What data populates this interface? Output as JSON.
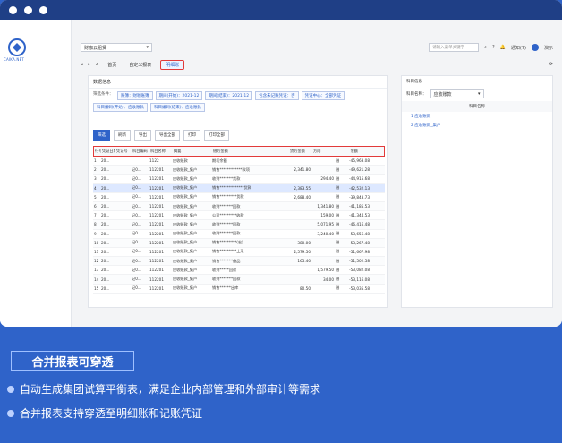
{
  "window": {
    "dots": 3
  },
  "brand": {
    "name": "财咖",
    "small": "CAIKA.NET"
  },
  "topbar": {
    "org_select": "财咖云租赁",
    "search_placeholder": "请输入菜单关键字",
    "notifications": "通知(7)",
    "user": "演示"
  },
  "tabs": [
    {
      "label": "首页"
    },
    {
      "label": "自定义报表"
    },
    {
      "label": "明细账"
    }
  ],
  "panel": {
    "title": "数据信息",
    "filter_label": "筛选条件：",
    "filters": [
      "账簿：财咖账簿",
      "期间(开始)：2021-12",
      "期间(结束)：2021-12",
      "包含未记账凭证：否",
      "凭证中心：全部凭证",
      "科目编码(开始)：应收账款",
      "科目编码(结束)：应收账款"
    ],
    "actions": [
      "筛选",
      "刷新",
      "导出",
      "导出全部",
      "打印",
      "打印全部"
    ],
    "columns": [
      "行号",
      "凭证日期",
      "凭证号",
      "科目编码",
      "科目名称",
      "摘要",
      "借方金额",
      "贷方金额",
      "方向",
      "余额"
    ],
    "rows": [
      [
        "1",
        "20...",
        "",
        "",
        "1122",
        "应收账款",
        "期初余额",
        "",
        "",
        "借",
        "-45,963.08"
      ],
      [
        "2",
        "20...",
        "",
        "记0...",
        "112201",
        "应收账款_集户",
        "销售************款项",
        "2,341.80",
        "",
        "借",
        "-49,621.28"
      ],
      [
        "3",
        "20...",
        "",
        "记0...",
        "112201",
        "应收账款_集户",
        "收到*******货款",
        "",
        "294.40",
        "借",
        "-44,915.68"
      ],
      [
        "4",
        "20...",
        "",
        "记0...",
        "112201",
        "应收账款_集户",
        "销售*************货款",
        "2,383.55",
        "",
        "借",
        "-42,532.13"
      ],
      [
        "5",
        "20...",
        "",
        "记0...",
        "112201",
        "应收账款_集户",
        "销售*********货款",
        "2,688.40",
        "",
        "借",
        "-39,843.73"
      ],
      [
        "6",
        "20...",
        "",
        "记0...",
        "112201",
        "应收账款_集户",
        "收到*******回款",
        "",
        "1,341.80",
        "借",
        "-41,185.53"
      ],
      [
        "7",
        "20...",
        "",
        "记0...",
        "112201",
        "应收账款_集户",
        "公司*********收款",
        "",
        "159.00",
        "借",
        "-41,344.53"
      ],
      [
        "8",
        "20...",
        "",
        "记0...",
        "112201",
        "应收账款_集户",
        "收到*******回款",
        "",
        "5,071.95",
        "借",
        "-46,416.48"
      ],
      [
        "9",
        "20...",
        "",
        "记0...",
        "112201",
        "应收账款_集户",
        "收到*******回款",
        "",
        "3,240.40",
        "借",
        "-53,656.48"
      ],
      [
        "10",
        "20...",
        "",
        "记0...",
        "112201",
        "应收账款_集户",
        "销售*********(宏)",
        "380.00",
        "",
        "借",
        "-53,267.48"
      ],
      [
        "11",
        "20...",
        "",
        "记0...",
        "112201",
        "应收账款_集户",
        "销售*********上采",
        "2,579.50",
        "",
        "借",
        "-51,667.98"
      ],
      [
        "12",
        "20...",
        "",
        "记0...",
        "112201",
        "应收账款_集户",
        "销售*******备品",
        "165.40",
        "",
        "借",
        "-51,502.58"
      ],
      [
        "13",
        "20...",
        "",
        "记0...",
        "112201",
        "应收账款_集户",
        "收到*****回款",
        "",
        "1,579.50",
        "借",
        "-53,082.08"
      ],
      [
        "14",
        "20...",
        "",
        "记0...",
        "112201",
        "应收账款_集户",
        "收到*******回款",
        "",
        "34.00",
        "借",
        "-53,116.08"
      ],
      [
        "15",
        "20...",
        "",
        "记0...",
        "112201",
        "应收账款_集户",
        "销售******出库",
        "80.50",
        "",
        "借",
        "-53,035.58"
      ]
    ]
  },
  "side": {
    "title": "科目信息",
    "label": "科目名称：",
    "select": "应收账款",
    "header": "科目名称",
    "tree": [
      "1  应收账款",
      "2  应收账款_集户"
    ]
  },
  "banner": {
    "title": "合并报表可穿透"
  },
  "bullets": [
    "自动生成集团试算平衡表，满足企业内部管理和外部审计等需求",
    "合并报表支持穿透至明细账和记账凭证"
  ]
}
